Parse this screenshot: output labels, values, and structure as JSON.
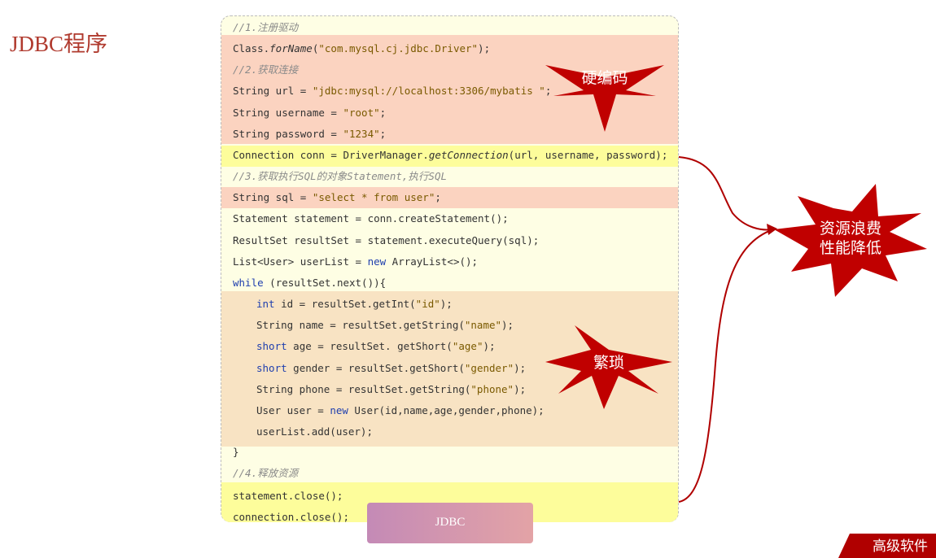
{
  "page_title": "JDBC程序",
  "code_lines": [
    [
      {
        "t": "//1.注册驱动",
        "c": "cmt"
      }
    ],
    [
      {
        "t": "Class."
      },
      {
        "t": "forName",
        "c": "mth"
      },
      {
        "t": "("
      },
      {
        "t": "\"com.mysql.cj.jdbc.Driver\"",
        "c": "str"
      },
      {
        "t": ");"
      }
    ],
    [
      {
        "t": "//2.获取连接",
        "c": "cmt"
      }
    ],
    [
      {
        "t": "String url = "
      },
      {
        "t": "\"jdbc:mysql://localhost:3306/mybatis \"",
        "c": "str"
      },
      {
        "t": ";"
      }
    ],
    [
      {
        "t": "String username = "
      },
      {
        "t": "\"root\"",
        "c": "str"
      },
      {
        "t": ";"
      }
    ],
    [
      {
        "t": "String password = "
      },
      {
        "t": "\"1234\"",
        "c": "str"
      },
      {
        "t": ";"
      }
    ],
    [
      {
        "t": "Connection conn = DriverManager."
      },
      {
        "t": "getConnection",
        "c": "mth"
      },
      {
        "t": "(url, username, password);"
      }
    ],
    [
      {
        "t": "//3.获取执行SQL的对象Statement,执行SQL",
        "c": "cmt"
      }
    ],
    [
      {
        "t": "String sql = "
      },
      {
        "t": "\"select * from user\"",
        "c": "str"
      },
      {
        "t": ";"
      }
    ],
    [
      {
        "t": "Statement statement = conn.createStatement();"
      }
    ],
    [
      {
        "t": "ResultSet resultSet = statement.executeQuery(sql);"
      }
    ],
    [
      {
        "t": "List<User> userList = "
      },
      {
        "t": "new",
        "c": "kw"
      },
      {
        "t": " ArrayList<>();"
      }
    ],
    [
      {
        "t": "while",
        "c": "kw"
      },
      {
        "t": " (resultSet.next()){"
      }
    ],
    [
      {
        "t": "int",
        "c": "kw"
      },
      {
        "t": " id = resultSet.getInt("
      },
      {
        "t": "\"id\"",
        "c": "str"
      },
      {
        "t": ");"
      }
    ],
    [
      {
        "t": "String name = resultSet.getString("
      },
      {
        "t": "\"name\"",
        "c": "str"
      },
      {
        "t": ");"
      }
    ],
    [
      {
        "t": "short",
        "c": "kw"
      },
      {
        "t": " age = resultSet. getShort("
      },
      {
        "t": "\"age\"",
        "c": "str"
      },
      {
        "t": ");"
      }
    ],
    [
      {
        "t": "short",
        "c": "kw"
      },
      {
        "t": " gender = resultSet.getShort("
      },
      {
        "t": "\"gender\"",
        "c": "str"
      },
      {
        "t": ");"
      }
    ],
    [
      {
        "t": "String phone = resultSet.getString("
      },
      {
        "t": "\"phone\"",
        "c": "str"
      },
      {
        "t": ");"
      }
    ],
    [
      {
        "t": "User user = "
      },
      {
        "t": "new",
        "c": "kw"
      },
      {
        "t": " User(id,name,age,gender,phone);"
      }
    ],
    [
      {
        "t": "userList.add(user);"
      }
    ],
    [
      {
        "t": "}"
      }
    ],
    [
      {
        "t": "//4.释放资源",
        "c": "cmt"
      }
    ],
    [
      {
        "t": "statement.close();"
      }
    ],
    [
      {
        "t": "connection.close();"
      }
    ]
  ],
  "callouts": {
    "hardcode": "硬编码",
    "tedious": "繁琐",
    "waste_line1": "资源浪费",
    "waste_line2": "性能降低"
  },
  "bottom_tab": "JDBC",
  "corner_text": "高级软件",
  "colors": {
    "title": "#b03a2e",
    "star": "#c00000",
    "arrow": "#b00000",
    "highlight_red": "#fbd3c0",
    "highlight_yellow": "#fdfd9b",
    "highlight_tan": "#f8e3c3",
    "code_bg": "#fefee4"
  }
}
